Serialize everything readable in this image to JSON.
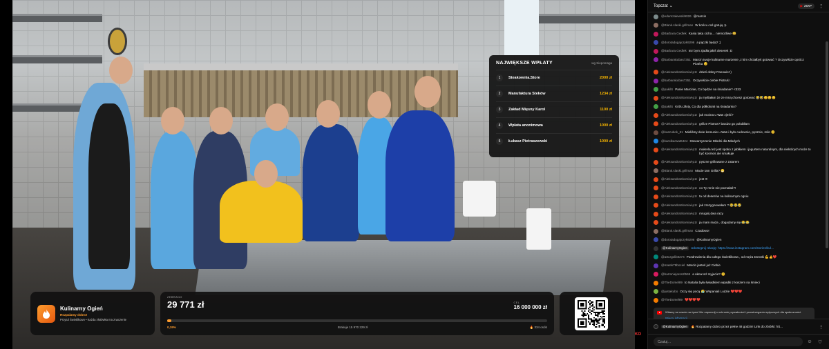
{
  "stream_overlay": {
    "top_donors": {
      "title": "NAJWIĘKSZE WPŁATY",
      "subtitle": "wg Siepomaga",
      "items": [
        {
          "rank": "1",
          "name": "Steakownia.Store",
          "amount": "2000 zł"
        },
        {
          "rank": "2",
          "name": "Manufaktura Steków",
          "amount": "1234 zł"
        },
        {
          "rank": "3",
          "name": "Zakład Mięsny Karol",
          "amount": "1100 zł"
        },
        {
          "rank": "4",
          "name": "Wpłata anonimowa",
          "amount": "1000 zł"
        },
        {
          "rank": "5",
          "name": "Łukasz Pietraszewski",
          "amount": "1000 zł"
        }
      ]
    },
    "brand": {
      "name": "Kulinarny Ogień",
      "subtitle": "Rozpalamy dobro!",
      "tagline": "Przytul Świetlikowo • Każda złotówka ma znaczenie"
    },
    "fundraiser": {
      "raised_label": "ZEBRANO",
      "raised": "29 771 zł",
      "goal_label": "CEL",
      "goal": "16 000 000 zł",
      "progress_fraction": 0.0019,
      "percent_text": "0,19%",
      "remaining_text": "Brakuje 15 970 229 zł",
      "donors_text": "334 osób"
    },
    "corner_logo": "KO"
  },
  "chat": {
    "mode_label": "Topczat",
    "points_label": "25XP",
    "messages": [
      {
        "author": "@edamzalewski9026",
        "text": "@marcin",
        "color": "#7b8a8b"
      },
      {
        "author": "@Blank.slaski.grillman",
        "text": "W końcu coś gotują :p",
        "color": "#8d6e63"
      },
      {
        "author": "@Barbara.Gedlek",
        "text": "Kasia taka cicha… niemożliwe 😄",
        "color": "#c2185b"
      },
      {
        "author": "@dorotadugajczyk9296",
        "text": "a pączki będą? ;)",
        "color": "#3949ab"
      },
      {
        "author": "@Barbara.Gedlek",
        "text": "tez bym zjadła jakiś deserek :D",
        "color": "#c2185b"
      },
      {
        "author": "@barbarakubas7351",
        "text": "Marcin twoje kulinarne marzenie ,z kim chciałbyś gotować ? Oczywiście oprócz Piotrka 😊",
        "color": "#8e24aa"
      },
      {
        "author": "@AleksandraSkomiał-p1r",
        "text": "dzień dobry Panowie!:)",
        "color": "#e64a19"
      },
      {
        "author": "@barbarakubas7351",
        "text": "Oczywiście ciebie Piotruś !",
        "color": "#8e24aa"
      },
      {
        "author": "@pakilS",
        "text": "Panie Marcinie, Co będzie na śniadanie? <333",
        "color": "#43a047"
      },
      {
        "author": "@AleksandraSkomiał-p1r",
        "text": "ja myślałam że ze mną chcesz gotować 🤣🤣😊😊😊",
        "color": "#e64a19"
      },
      {
        "author": "@pakilS",
        "text": "Królu Złoty, Co dla półkolonii na śniadanko?",
        "color": "#43a047"
      },
      {
        "author": "@AleksandraSkomiał-p1r",
        "text": "jak można u Was zjeść?",
        "color": "#e64a19"
      },
      {
        "author": "@AleksandraSkomiał-p1r",
        "text": "grillze Piotrus? bardzo go polubiłam",
        "color": "#e64a19"
      },
      {
        "author": "@kaszubek_81",
        "text": "Mieliśmy dwie komunie u Was i było cudownie, pysznie, miło 😊",
        "color": "#6d4c41"
      },
      {
        "author": "@karolkarwat6424",
        "text": "Stowarzyszenie Młodzi dla Młodych",
        "color": "#1e88e5"
      },
      {
        "author": "@AleksandraSkomiał-p1r",
        "text": "makrela też jest spoko z jabłkiem i jogurtem naturalnym, dla niektórych może to być kosmos ale smakuje",
        "color": "#e64a19"
      },
      {
        "author": "@AleksandraSkomiał-p1r",
        "text": "pyszne grillowane z zatarem",
        "color": "#e64a19"
      },
      {
        "author": "@Blank.slaski.grillman",
        "text": "Macie tam Grilla? 😁",
        "color": "#8d6e63"
      },
      {
        "author": "@AleksandraSkomiał-p1r",
        "text": "jest !!!",
        "color": "#e64a19"
      },
      {
        "author": "@AleksandraSkomiał-p1r",
        "text": "co Ty mnie nie poznałaś?!",
        "color": "#e64a19"
      },
      {
        "author": "@AleksandraSkomiał-p1r",
        "text": "ta od deserów na kulinarnym ogniu",
        "color": "#e64a19"
      },
      {
        "author": "@AleksandraSkomiał-p1r",
        "text": "jak zrezygnowałam ? 😂😂😂",
        "color": "#e64a19"
      },
      {
        "author": "@AleksandraSkomiał-p1r",
        "text": "mrugnij dwa razy",
        "color": "#e64a19"
      },
      {
        "author": "@AleksandraSkomiał-p1r",
        "text": "ja mam męża , dogadamy się 😂😂",
        "color": "#e64a19"
      },
      {
        "author": "@Blank.slaski.grillman",
        "text": "Czadowo!",
        "color": "#8d6e63"
      },
      {
        "author": "@dorotadugajczyk9296",
        "text": "@KulinarnyOgien",
        "color": "#3949ab"
      },
      {
        "author": "@KulinarnyOgien",
        "text": "Udostępnij relację: https://www.instagram.com/stories/kul…",
        "color": "#333333",
        "mod": true
      },
      {
        "author": "@arturgolik8274",
        "text": "Pozdrowienia dla całego Świetlikowa , od męża Dorotki 💪👍❤️",
        "color": "#00897b"
      },
      {
        "author": "@matek79bociel",
        "text": "Marcin jesteś już Ciebie",
        "color": "#5e35b1"
      },
      {
        "author": "@bartoniejaroszl565",
        "text": "a okna też myjecie? 😊",
        "color": "#d81b60"
      },
      {
        "author": "@TheDomel89",
        "text": "to Natalia była świadkiem wpadki z koszem na śmieci",
        "color": "#f57c00"
      },
      {
        "author": "@justakubo",
        "text": "Oczy się pocą 😭 Wspaniali Ludzie ❤️❤️❤️",
        "color": "#7cb342"
      },
      {
        "author": "@TheDomel89",
        "text": "❤️❤️❤️❤️",
        "color": "#f57c00"
      }
    ],
    "notice": {
      "text": "Witamy na czacie na żywo! Nie zapomnij o ochronie prywatności i przestrzeganiu wytycznych dla społeczności.",
      "link": "Więcej informacji"
    },
    "after_notice": [
      {
        "author": "@joannaceleda2769",
        "text": "❤️❤️❤️❤️",
        "color": "#fb8c00"
      }
    ],
    "pinned": {
      "author": "@KulinarnyOgien",
      "text": "🔥 Rozpalamy dobro przez pełne 48 godzin! Link do zbiórki: htt…"
    },
    "input_placeholder": "Czatuj…"
  }
}
